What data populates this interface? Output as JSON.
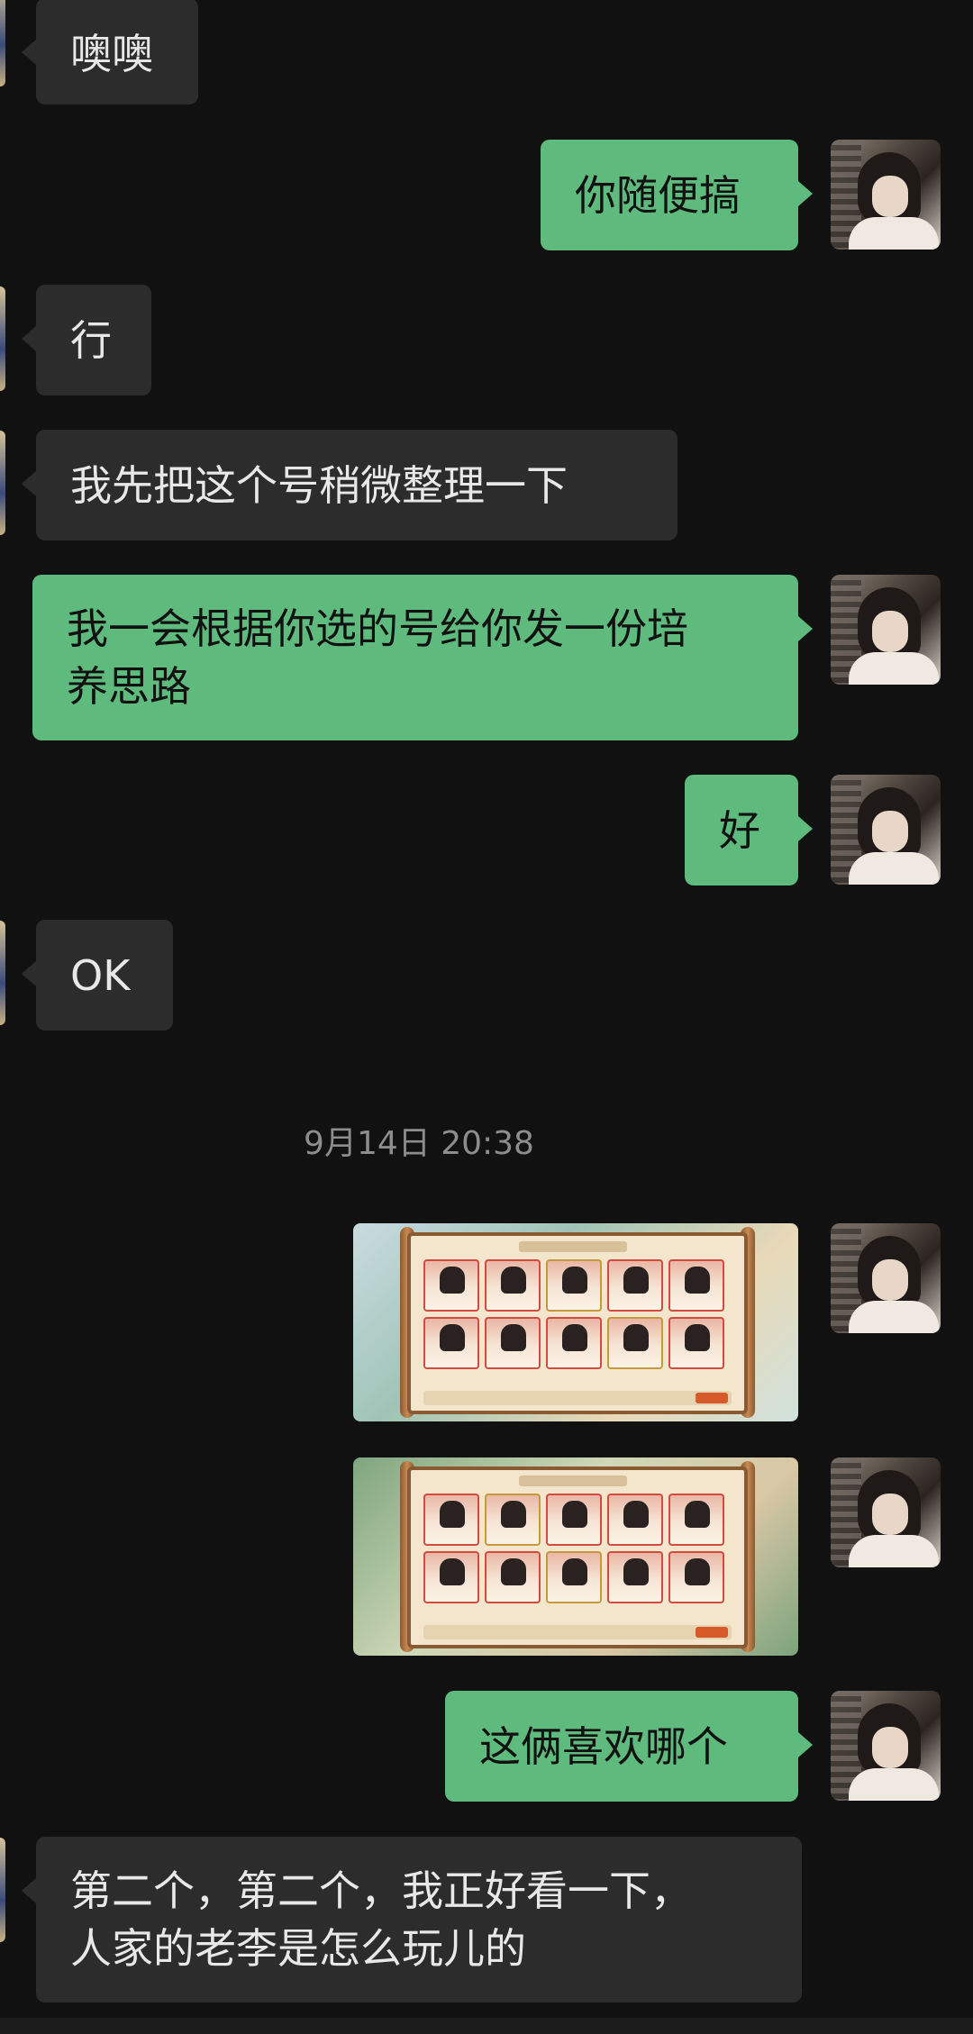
{
  "messages": [
    {
      "id": "m1",
      "side": "in",
      "text": "噢噢"
    },
    {
      "id": "m2",
      "side": "out",
      "text": "你随便搞"
    },
    {
      "id": "m3",
      "side": "in",
      "text": "行"
    },
    {
      "id": "m4",
      "side": "in",
      "text": "我先把这个号稍微整理一下"
    },
    {
      "id": "m5",
      "side": "out",
      "text": "我一会根据你选的号给你发一份培\n养思路"
    },
    {
      "id": "m6",
      "side": "out",
      "text": "好"
    },
    {
      "id": "m7",
      "side": "in",
      "text": "OK"
    },
    {
      "id": "m8",
      "side": "out",
      "text": "这俩喜欢哪个"
    },
    {
      "id": "m9",
      "side": "in",
      "text": "第二个，第二个，我正好看一下，\n人家的老李是怎么玩儿的"
    }
  ],
  "timestamp": "9月14日 20:38",
  "colors": {
    "background": "#111111",
    "incoming_bubble": "#2c2c2c",
    "outgoing_bubble": "#5fba7d",
    "timestamp_text": "#8d8d8d"
  },
  "images": [
    {
      "id": "img1",
      "kind": "game-screenshot-thumbnail"
    },
    {
      "id": "img2",
      "kind": "game-screenshot-thumbnail"
    }
  ]
}
